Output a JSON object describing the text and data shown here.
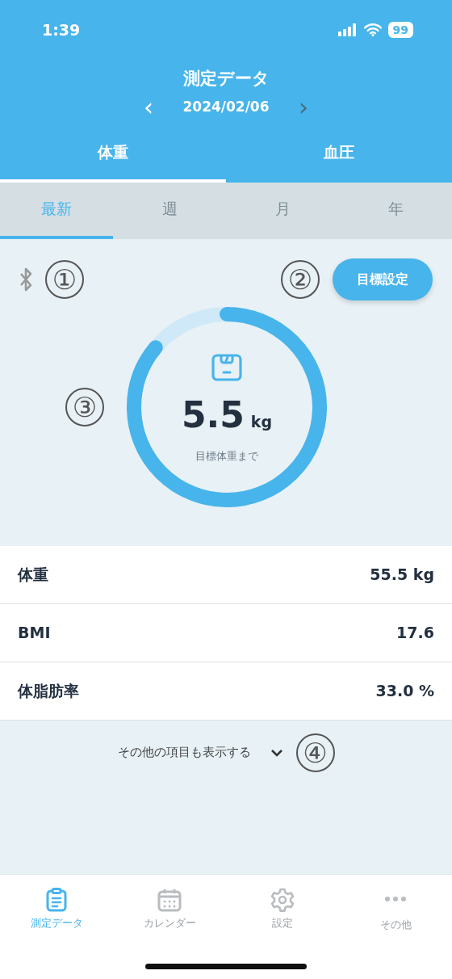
{
  "status_bar": {
    "time": "1:39",
    "battery": "99"
  },
  "header": {
    "title": "測定データ",
    "date": "2024/02/06",
    "prev": "‹",
    "next": "›"
  },
  "tabs": [
    {
      "label": "体重",
      "selected": true
    },
    {
      "label": "血圧",
      "selected": false
    }
  ],
  "period_tabs": [
    {
      "label": "最新",
      "selected": true
    },
    {
      "label": "週",
      "selected": false
    },
    {
      "label": "月",
      "selected": false
    },
    {
      "label": "年",
      "selected": false
    }
  ],
  "bluetooth_connected": false,
  "annotations": [
    "①",
    "②",
    "③",
    "④"
  ],
  "goal_button": "目標設定",
  "goal_ring": {
    "level": 0.86,
    "value": "5.5",
    "unit": "kg",
    "caption": "目標体重まで"
  },
  "metrics": [
    {
      "label": "体重",
      "value": "55.5 kg"
    },
    {
      "label": "BMI",
      "value": "17.6"
    },
    {
      "label": "体脂肪率",
      "value": "33.0 %"
    }
  ],
  "show_more": "その他の項目も表示する",
  "bottom_nav": [
    {
      "label": "測定データ",
      "selected": true
    },
    {
      "label": "カレンダー",
      "selected": false
    },
    {
      "label": "設定",
      "selected": false
    },
    {
      "label": "その他",
      "selected": false
    }
  ]
}
